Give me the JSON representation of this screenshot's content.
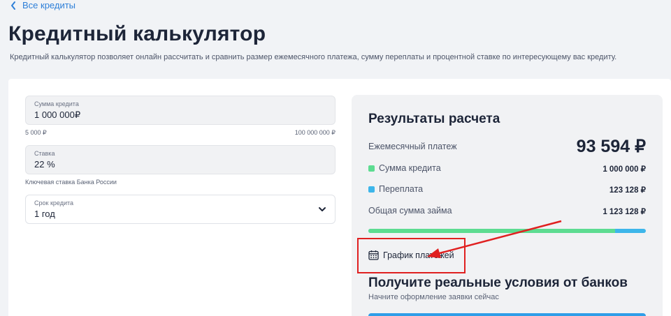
{
  "nav": {
    "back_label": "Все кредиты"
  },
  "page": {
    "title": "Кредитный калькулятор",
    "description": "Кредитный калькулятор позволяет онлайн рассчитать и сравнить размер ежемесячного платежа, сумму переплаты и процентной ставке по интересующему вас кредиту."
  },
  "form": {
    "amount": {
      "label": "Сумма кредита",
      "value": "1 000 000₽",
      "min_label": "5 000 ₽",
      "max_label": "100 000 000 ₽"
    },
    "rate": {
      "label": "Ставка",
      "value": "22 %",
      "hint": "Ключевая ставка Банка России"
    },
    "term": {
      "label": "Срок кредита",
      "value": "1 год"
    }
  },
  "results": {
    "title": "Результаты расчета",
    "monthly_label": "Ежемесячный платеж",
    "monthly_value": "93 594 ₽",
    "principal_label": "Сумма кредита",
    "principal_value": "1 000 000 ₽",
    "overpay_label": "Переплата",
    "overpay_value": "123 128 ₽",
    "total_label": "Общая сумма займа",
    "total_value": "1 123 128 ₽",
    "principal_fraction": 0.89,
    "schedule_label": "График платежей"
  },
  "banks": {
    "title": "Получите реальные условия от банков",
    "subtitle": "Начните оформление заявки сейчас"
  },
  "colors": {
    "accent": "#2d7fd8",
    "principal": "#5ddc91",
    "overpay": "#3db6ea",
    "annotation": "#e02020"
  }
}
